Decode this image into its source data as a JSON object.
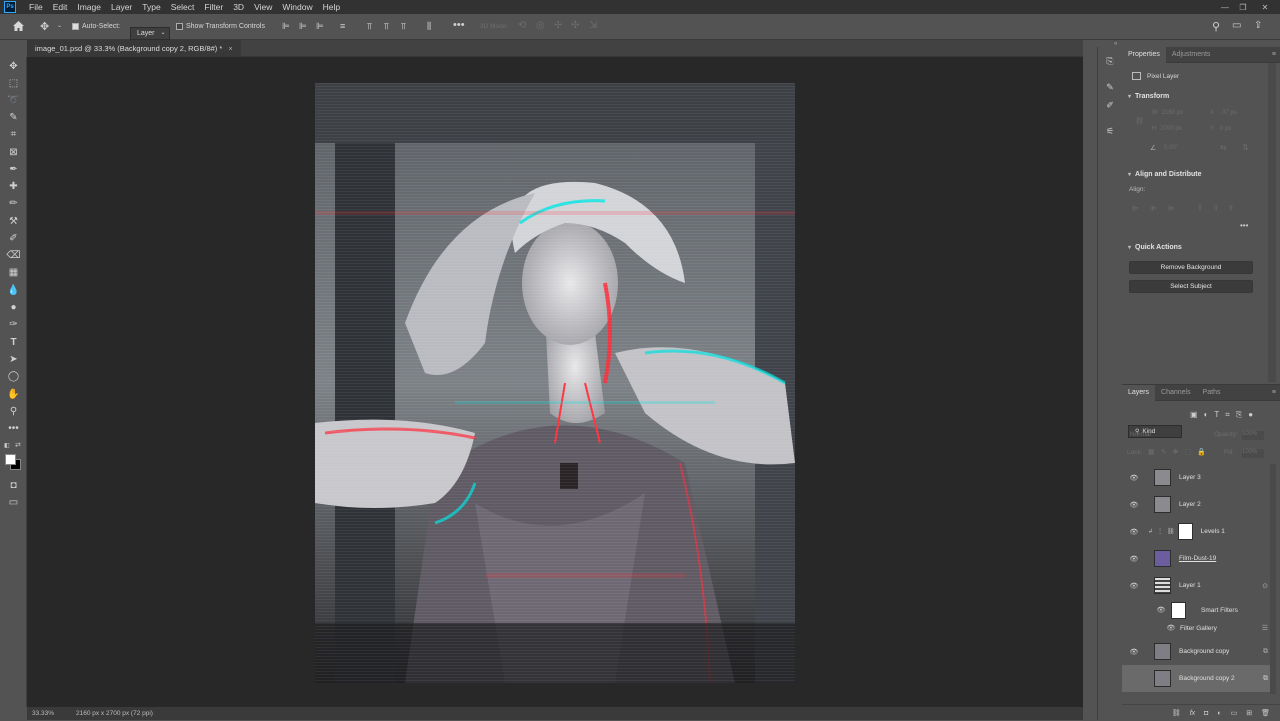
{
  "app": {
    "logo_text": "Ps"
  },
  "menu": [
    "File",
    "Edit",
    "Image",
    "Layer",
    "Type",
    "Select",
    "Filter",
    "3D",
    "View",
    "Window",
    "Help"
  ],
  "options": {
    "auto_select_label": "Auto-Select:",
    "auto_select_value": "Layer",
    "transform_controls_label": "Show Transform Controls",
    "mode_label": "3D Mode:"
  },
  "document": {
    "tab_title": "image_01.psd @ 33.3% (Background copy 2, RGB/8#) *",
    "close_glyph": "×"
  },
  "status": {
    "zoom": "33.33%",
    "size": "2160 px x 2700 px (72 ppi)"
  },
  "properties": {
    "tabs": [
      "Properties",
      "Adjustments"
    ],
    "layer_type": "Pixel Layer",
    "transform_title": "Transform",
    "w_label": "W",
    "w_value": "2160 px",
    "h_label": "H",
    "h_value": "2700 px",
    "x_label": "X",
    "x_value": "-37 px",
    "y_label": "Y",
    "y_value": "0 px",
    "angle_value": "0.00°",
    "align_title": "Align and Distribute",
    "align_label": "Align:",
    "quick_actions_title": "Quick Actions",
    "remove_bg_label": "Remove Background",
    "select_subject_label": "Select Subject"
  },
  "layers_panel": {
    "tabs": [
      "Layers",
      "Channels",
      "Paths"
    ],
    "kind_label": "Kind",
    "blend_mode": "Normal",
    "opacity_label": "Opacity:",
    "opacity_value": "100%",
    "lock_label": "Lock:",
    "fill_label": "Fill:",
    "fill_value": "100%",
    "layers": [
      {
        "name": "Layer 3"
      },
      {
        "name": "Layer 2"
      },
      {
        "name": "Levels 1"
      },
      {
        "name": "Film-Dust-19"
      },
      {
        "name": "Layer 1"
      },
      {
        "name": "Smart Filters"
      },
      {
        "name": "Filter Gallery"
      },
      {
        "name": "Background copy"
      },
      {
        "name": "Background copy 2"
      }
    ]
  },
  "colors": {
    "accent": "#31a8ff",
    "canvas_bg": "#282828",
    "panel_bg": "#535353"
  }
}
